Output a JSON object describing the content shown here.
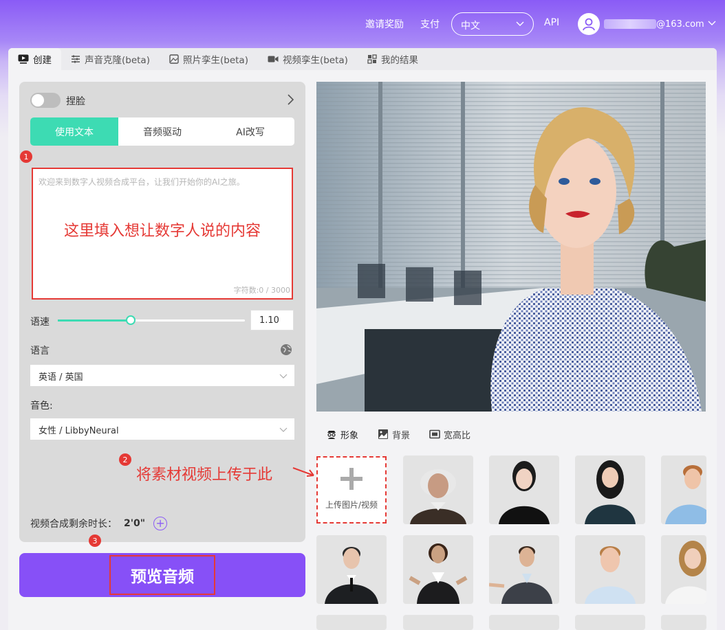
{
  "header": {
    "invite": "邀请奖励",
    "pay": "支付",
    "language": "中文",
    "api": "API",
    "email_suffix": "@163.com"
  },
  "tabs": [
    {
      "label": "创建",
      "icon": "video-create-icon"
    },
    {
      "label": "声音克隆(beta)",
      "icon": "sliders-icon"
    },
    {
      "label": "照片孪生(beta)",
      "icon": "photo-icon"
    },
    {
      "label": "视频孪生(beta)",
      "icon": "camera-icon"
    },
    {
      "label": "我的结果",
      "icon": "grid-icon"
    }
  ],
  "left": {
    "toggle_label": "捏脸",
    "modes": [
      "使用文本",
      "音频驱动",
      "AI改写"
    ],
    "badge1": "1",
    "badge2": "2",
    "badge3": "3",
    "textarea_placeholder": "欢迎来到数字人视频合成平台，让我们开始你的AI之旅。",
    "textarea_hint": "这里填入想让数字人说的内容",
    "char_count": "字符数:0 / 3000",
    "speed_label": "语速",
    "speed_value": "1.10",
    "speed_fraction": 0.39,
    "language_label": "语言",
    "language_value": "英语 / 英国",
    "voice_label": "音色:",
    "voice_value": "女性 / LibbyNeural",
    "remaining_label": "视频合成剩余时长：",
    "remaining_value": "2'0\""
  },
  "preview_button": "预览音频",
  "right": {
    "categories": [
      "形象",
      "背景",
      "宽高比"
    ],
    "upload_label": "上传图片/视频",
    "annotation": "将素材视频上传于此"
  },
  "colors": {
    "accent_purple": "#8750f7",
    "accent_green": "#3ddbb3",
    "annotation_red": "#e53935"
  }
}
